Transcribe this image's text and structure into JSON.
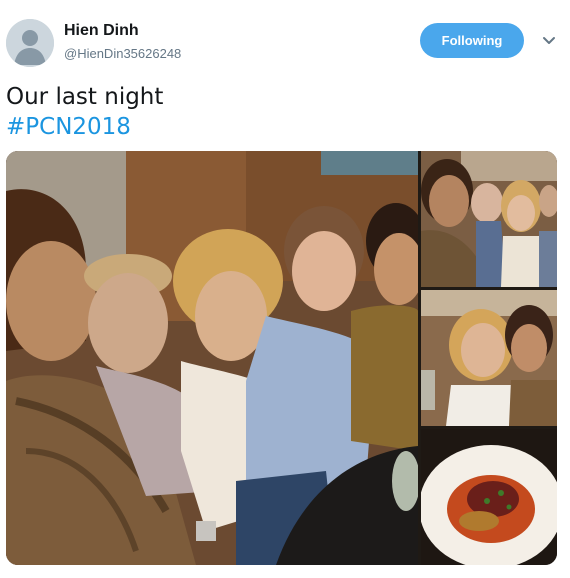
{
  "author": {
    "display_name": "Hien Dinh",
    "handle": "@HienDin35626248",
    "avatar_icon": "default-profile-icon"
  },
  "actions": {
    "follow_label": "Following",
    "follow_color": "#4aa7ec",
    "caret_icon": "chevron-down-icon"
  },
  "tweet": {
    "text": "Our last night",
    "hashtag": "#PCN2018",
    "hashtag_color": "#1b95e0"
  },
  "media": {
    "photos": [
      {
        "description_icon": "group-selfie-photo"
      },
      {
        "description_icon": "group-photo"
      },
      {
        "description_icon": "two-friends-photo"
      },
      {
        "description_icon": "food-plate-photo"
      }
    ]
  }
}
